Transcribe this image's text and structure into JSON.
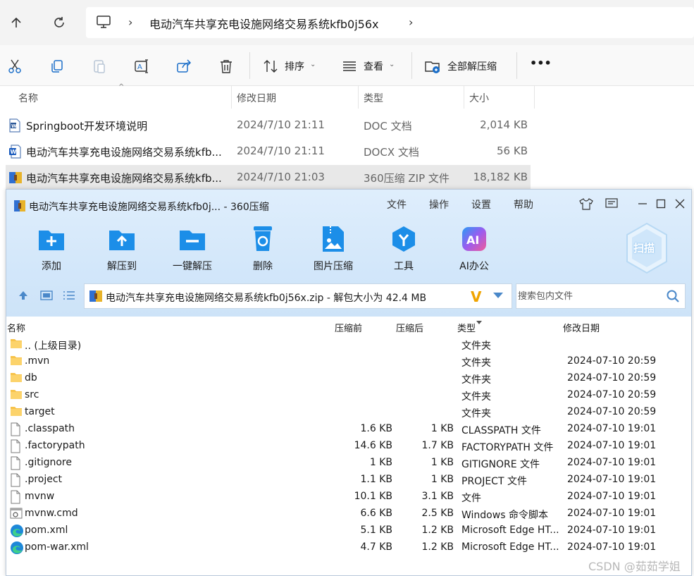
{
  "explorer": {
    "breadcrumb": "电动汽车共享充电设施网络交易系统kfb0j56x",
    "toolbar": {
      "sort_label": "排序",
      "view_label": "查看",
      "extract_all_label": "全部解压缩",
      "more_label": "•••"
    },
    "columns": {
      "name": "名称",
      "modified": "修改日期",
      "type": "类型",
      "size": "大小"
    },
    "files": [
      {
        "name": "Springboot开发环境说明",
        "modified": "2024/7/10 21:11",
        "type": "DOC 文档",
        "size": "2,014 KB",
        "icon": "word-doc-icon"
      },
      {
        "name": "电动汽车共享充电设施网络交易系统kfb...",
        "modified": "2024/7/10 21:11",
        "type": "DOCX 文档",
        "size": "56 KB",
        "icon": "word-docx-icon"
      },
      {
        "name": "电动汽车共享充电设施网络交易系统kfb...",
        "modified": "2024/7/10 21:03",
        "type": "360压缩 ZIP 文件",
        "size": "18,182 KB",
        "icon": "zip-archive-icon",
        "selected": true
      }
    ]
  },
  "zip_window": {
    "title": "电动汽车共享充电设施网络交易系统kfb0j... - 360压缩",
    "menu": [
      "文件",
      "操作",
      "设置",
      "帮助"
    ],
    "actions": [
      {
        "label": "添加",
        "icon": "add-folder-icon"
      },
      {
        "label": "解压到",
        "icon": "extract-to-icon"
      },
      {
        "label": "一键解压",
        "icon": "one-click-extract-icon"
      },
      {
        "label": "删除",
        "icon": "recycle-bin-icon"
      },
      {
        "label": "图片压缩",
        "icon": "image-compress-icon"
      },
      {
        "label": "工具",
        "icon": "tools-icon"
      },
      {
        "label": "AI办公",
        "icon": "ai-office-icon"
      }
    ],
    "scan_label": "扫描",
    "ai_badge": "AI",
    "path_text": "电动汽车共享充电设施网络交易系统kfb0j56x.zip - 解包大小为 42.4 MB",
    "vlogo": "V",
    "search_placeholder": "搜索包内文件",
    "columns": {
      "name": "名称",
      "before": "压缩前",
      "after": "压缩后",
      "type": "类型",
      "modified": "修改日期"
    },
    "entries": [
      {
        "name": ".. (上级目录)",
        "before": "",
        "after": "",
        "type": "文件夹",
        "modified": "",
        "icon": "folder-icon"
      },
      {
        "name": ".mvn",
        "before": "",
        "after": "",
        "type": "文件夹",
        "modified": "2024-07-10 20:59",
        "icon": "folder-icon"
      },
      {
        "name": "db",
        "before": "",
        "after": "",
        "type": "文件夹",
        "modified": "2024-07-10 20:59",
        "icon": "folder-icon"
      },
      {
        "name": "src",
        "before": "",
        "after": "",
        "type": "文件夹",
        "modified": "2024-07-10 20:59",
        "icon": "folder-icon"
      },
      {
        "name": "target",
        "before": "",
        "after": "",
        "type": "文件夹",
        "modified": "2024-07-10 20:59",
        "icon": "folder-icon"
      },
      {
        "name": ".classpath",
        "before": "1.6 KB",
        "after": "1 KB",
        "type": "CLASSPATH 文件",
        "modified": "2024-07-10 19:01",
        "icon": "file-icon"
      },
      {
        "name": ".factorypath",
        "before": "14.6 KB",
        "after": "1.7 KB",
        "type": "FACTORYPATH 文件",
        "modified": "2024-07-10 19:01",
        "icon": "file-icon"
      },
      {
        "name": ".gitignore",
        "before": "1 KB",
        "after": "1 KB",
        "type": "GITIGNORE 文件",
        "modified": "2024-07-10 19:01",
        "icon": "file-icon"
      },
      {
        "name": ".project",
        "before": "1.1 KB",
        "after": "1 KB",
        "type": "PROJECT 文件",
        "modified": "2024-07-10 19:01",
        "icon": "file-icon"
      },
      {
        "name": "mvnw",
        "before": "10.1 KB",
        "after": "3.1 KB",
        "type": "文件",
        "modified": "2024-07-10 19:01",
        "icon": "file-icon"
      },
      {
        "name": "mvnw.cmd",
        "before": "6.6 KB",
        "after": "2.5 KB",
        "type": "Windows 命令脚本",
        "modified": "2024-07-10 19:01",
        "icon": "cmd-script-icon"
      },
      {
        "name": "pom.xml",
        "before": "5.1 KB",
        "after": "1.2 KB",
        "type": "Microsoft Edge HT...",
        "modified": "2024-07-10 19:01",
        "icon": "edge-icon"
      },
      {
        "name": "pom-war.xml",
        "before": "4.7 KB",
        "after": "1.2 KB",
        "type": "Microsoft Edge HT...",
        "modified": "2024-07-10 19:01",
        "icon": "edge-icon"
      }
    ]
  },
  "watermark": "CSDN @茹茹学姐",
  "colors": {
    "accent_blue": "#1c8ee8",
    "folder_yellow": "#f7c34a",
    "selection_gray": "#e8e8e8",
    "zip_header_bg": "#d3e7fa"
  }
}
